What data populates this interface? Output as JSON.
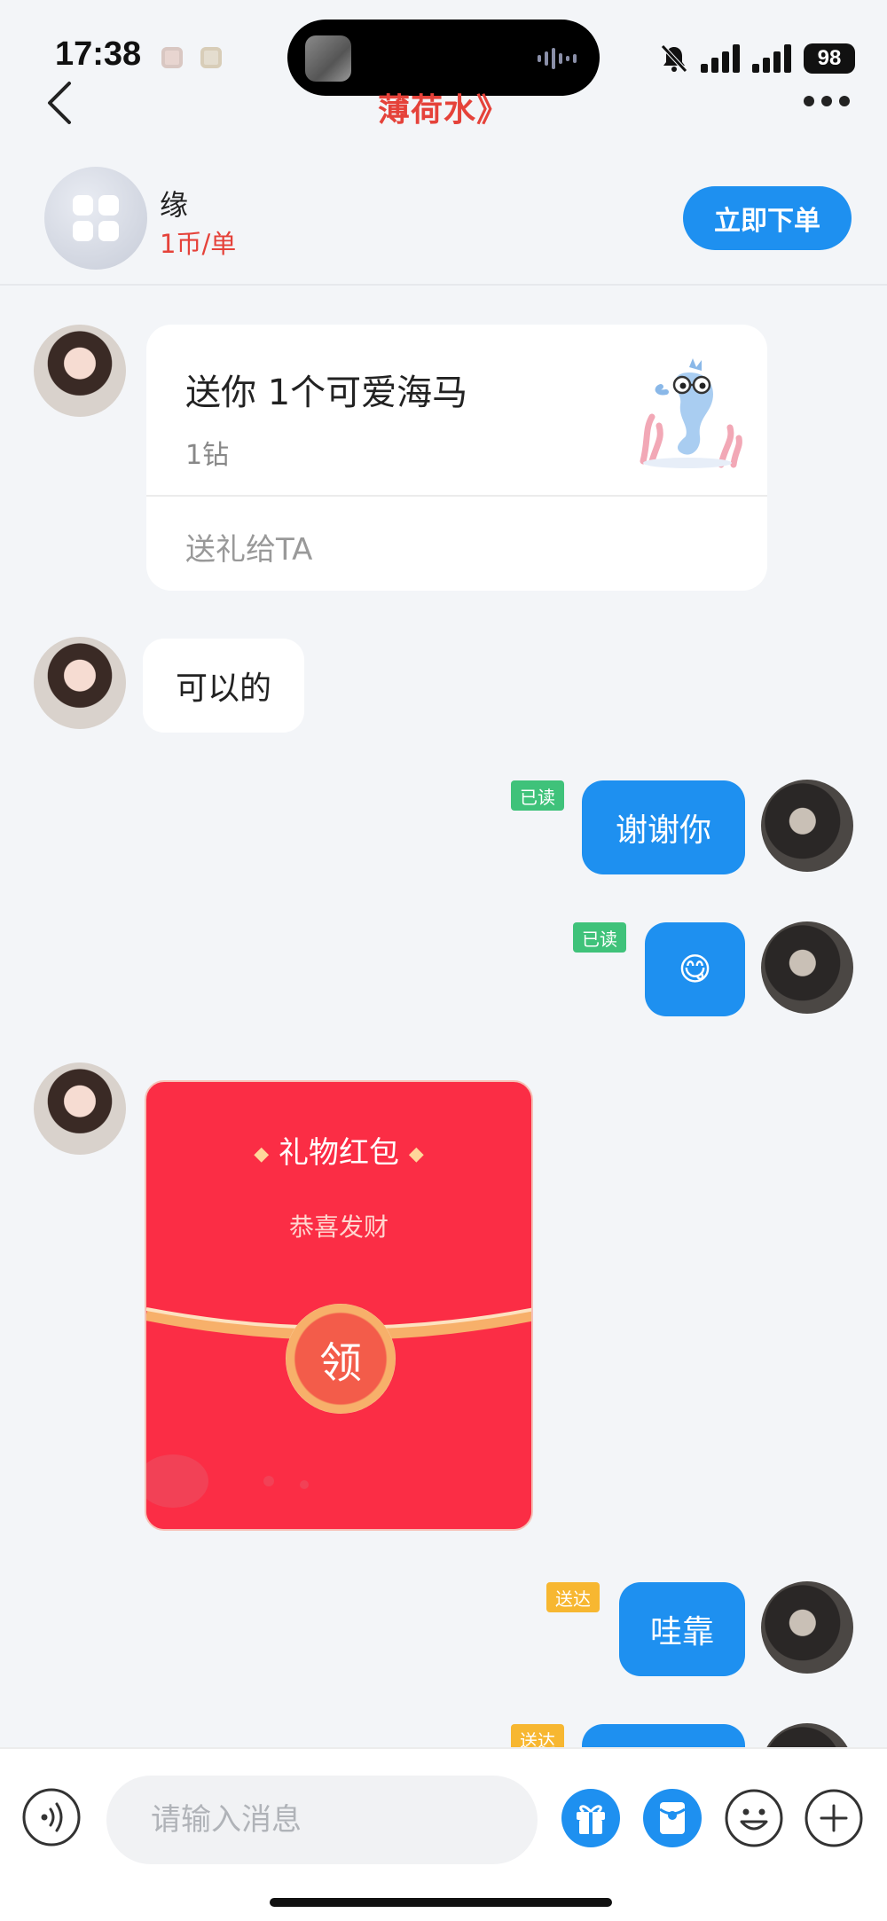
{
  "status_bar": {
    "time": "17:38",
    "battery": "98"
  },
  "nav": {
    "title": "薄荷水》"
  },
  "order_header": {
    "service_name": "缘",
    "price": "1币/单",
    "order_button": "立即下单"
  },
  "messages": {
    "gift_card": {
      "title": "送你 1个可爱海马",
      "price": "1钻",
      "action": "送礼给TA",
      "image_icon": "seahorse-icon"
    },
    "msg_in_1": "可以的",
    "msg_out_1": {
      "text": "谢谢你",
      "status": "已读"
    },
    "msg_out_2": {
      "text": "😋",
      "status": "已读"
    },
    "red_packet": {
      "title": "礼物红包",
      "subtitle": "恭喜发财",
      "button": "领"
    },
    "msg_out_3": {
      "text": "哇靠",
      "status": "送达"
    },
    "msg_out_4": {
      "status": "送达"
    }
  },
  "input_bar": {
    "placeholder": "请输入消息",
    "icons": [
      "voice-icon",
      "gift-icon",
      "red-packet-icon",
      "emoji-icon",
      "plus-icon"
    ]
  },
  "colors": {
    "accent_blue": "#1e90f0",
    "title_red": "#e5423a",
    "read_green": "#3fc27a",
    "sent_orange": "#f7b731",
    "packet_red": "#fb2d45"
  }
}
